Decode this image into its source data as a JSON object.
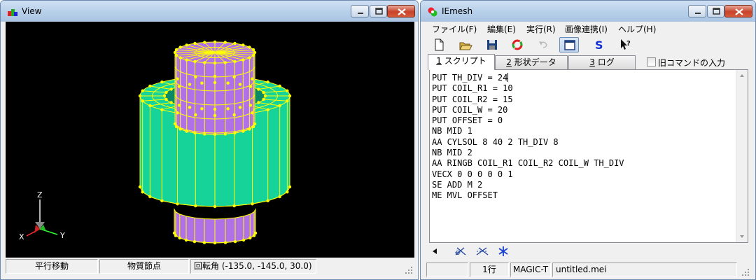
{
  "view_window": {
    "title": "View",
    "status": [
      "平行移動",
      "物質節点",
      "回転角 (-135.0, -145.0, 30.0)"
    ],
    "axes": {
      "z": "Z",
      "x": "X",
      "y": "Y"
    }
  },
  "iemesh_window": {
    "title": "IEmesh",
    "menu": [
      "ファイル(F)",
      "編集(E)",
      "実行(R)",
      "画像連携(I)",
      "ヘルプ(H)"
    ],
    "toolbar_icons": [
      "new-file-icon",
      "open-folder-icon",
      "save-icon",
      "run-icon",
      "undo-icon",
      "window-icon",
      "s-icon",
      "help-pointer-icon"
    ],
    "tabs": [
      {
        "key": "1",
        "label": "スクリプト"
      },
      {
        "key": "2",
        "label": "形状データ"
      },
      {
        "key": "3",
        "label": "ログ"
      }
    ],
    "old_command_checkbox": {
      "label": "旧コマンドの入力",
      "checked": false
    },
    "script_lines": [
      "PUT TH_DIV = 24",
      "PUT COIL_R1 = 10",
      "PUT COIL_R2 = 15",
      "PUT COIL_W = 20",
      "PUT OFFSET = 0",
      "NB MID 1",
      "AA CYLSOL 8 40 2 TH_DIV 8",
      "NB MID 2",
      "AA RINGB COIL_R1 COIL_R2 COIL_W TH_DIV",
      "VECX 0 0 0 0 0 1",
      "SE ADD M 2",
      "ME MVL OFFSET"
    ],
    "status": [
      "1行",
      "MAGIC-T",
      "untitled.mei"
    ]
  },
  "colors": {
    "purple": "#b070e8",
    "green": "#16d39a",
    "wire": "#ffff00",
    "viewport_bg": "#000000"
  }
}
